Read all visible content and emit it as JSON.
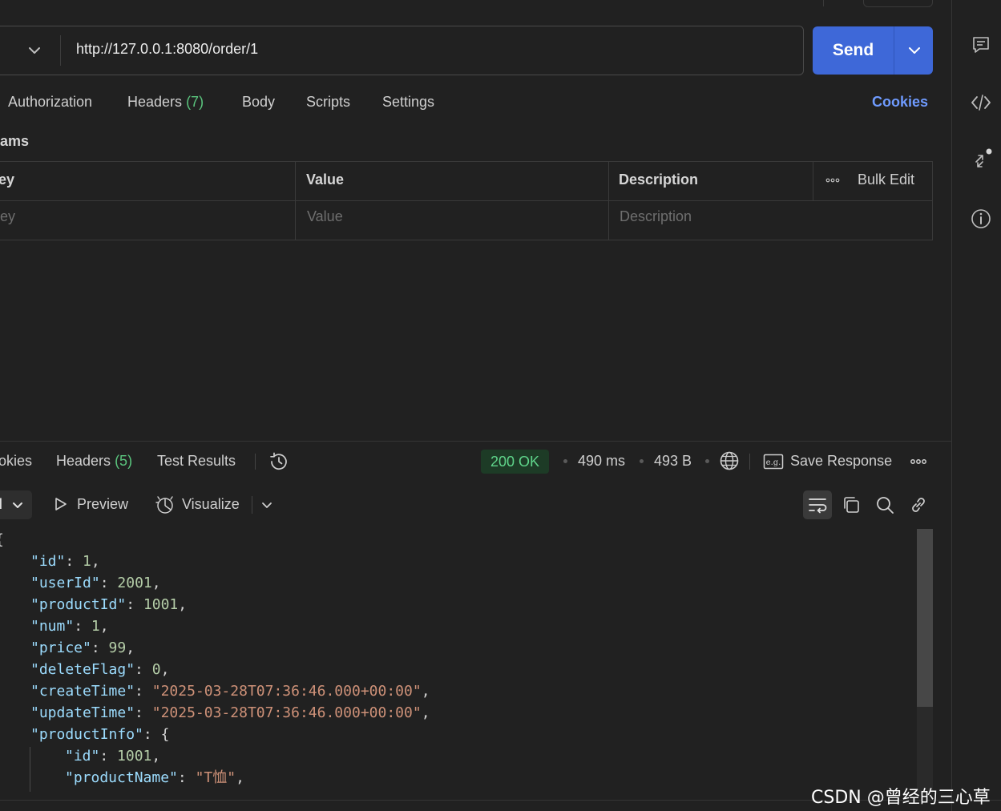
{
  "request": {
    "url": "http://127.0.0.1:8080/order/1",
    "send_label": "Send"
  },
  "request_tabs": {
    "authorization": "Authorization",
    "headers_label": "Headers",
    "headers_count": "(7)",
    "body": "Body",
    "scripts": "Scripts",
    "settings": "Settings",
    "cookies": "Cookies"
  },
  "params": {
    "section_label": "ams",
    "columns": {
      "key": "ey",
      "value": "Value",
      "description": "Description"
    },
    "bulk_edit": "Bulk Edit",
    "placeholders": {
      "key": "Key",
      "value": "Value",
      "description": "Description"
    }
  },
  "response_tabs": {
    "cookies": "okies",
    "headers_label": "Headers",
    "headers_count": "(5)",
    "test_results": "Test Results"
  },
  "response_status": {
    "status": "200 OK",
    "time": "490 ms",
    "size": "493 B",
    "save_response": "Save Response"
  },
  "response_toolbar": {
    "format_value": "l",
    "preview": "Preview",
    "visualize": "Visualize"
  },
  "response_body": {
    "open_brace": "{",
    "lines": [
      {
        "key": "\"id\"",
        "value": "1",
        "type": "number",
        "indent": 1
      },
      {
        "key": "\"userId\"",
        "value": "2001",
        "type": "number",
        "indent": 1
      },
      {
        "key": "\"productId\"",
        "value": "1001",
        "type": "number",
        "indent": 1
      },
      {
        "key": "\"num\"",
        "value": "1",
        "type": "number",
        "indent": 1
      },
      {
        "key": "\"price\"",
        "value": "99",
        "type": "number",
        "indent": 1
      },
      {
        "key": "\"deleteFlag\"",
        "value": "0",
        "type": "number",
        "indent": 1
      },
      {
        "key": "\"createTime\"",
        "value": "\"2025-03-28T07:36:46.000+00:00\"",
        "type": "string",
        "indent": 1
      },
      {
        "key": "\"updateTime\"",
        "value": "\"2025-03-28T07:36:46.000+00:00\"",
        "type": "string",
        "indent": 1
      },
      {
        "key": "\"productInfo\"",
        "value": "{",
        "type": "object",
        "indent": 1
      },
      {
        "key": "\"id\"",
        "value": "1001",
        "type": "number",
        "indent": 2
      },
      {
        "key": "\"productName\"",
        "value": "\"T恤\"",
        "type": "string",
        "indent": 2
      }
    ]
  },
  "watermark": "CSDN @曾经的三心草",
  "colors": {
    "send": "#3e68d8",
    "cookies_link": "#6f9bff",
    "status_ok": "#5fd48a",
    "json_key": "#9cdcfe",
    "json_number": "#b5cea8",
    "json_string": "#ce9178"
  },
  "icons": {
    "sidebar": [
      "comment-icon",
      "code-icon",
      "related-collections-icon",
      "info-icon"
    ],
    "response": [
      "history-icon",
      "globe-icon",
      "save-example-icon",
      "more-icon"
    ],
    "toolbar": [
      "wrap-lines-icon",
      "copy-icon",
      "search-icon",
      "link-icon"
    ]
  }
}
